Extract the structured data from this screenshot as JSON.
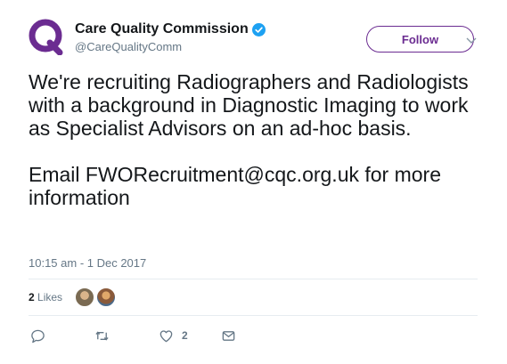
{
  "account": {
    "display_name": "Care Quality Commission",
    "handle": "@CareQualityComm",
    "verified_icon": "verified-check-icon",
    "brand_color": "#6b2c91",
    "verified_color": "#1da1f2"
  },
  "follow_button": {
    "label": "Follow"
  },
  "tweet": {
    "paragraphs": [
      "We're recruiting Radiographers and Radiologists with a background in Diagnostic Imaging to work as Specialist Advisors on an ad-hoc basis.",
      "Email FWORecruitment@cqc.org.uk for more information"
    ],
    "timestamp": "10:15 am - 1 Dec 2017"
  },
  "likes": {
    "count": "2",
    "label": "Likes"
  },
  "actions": {
    "reply_icon": "reply-icon",
    "retweet_icon": "retweet-icon",
    "like_icon": "heart-icon",
    "like_count": "2",
    "dm_icon": "envelope-icon"
  }
}
